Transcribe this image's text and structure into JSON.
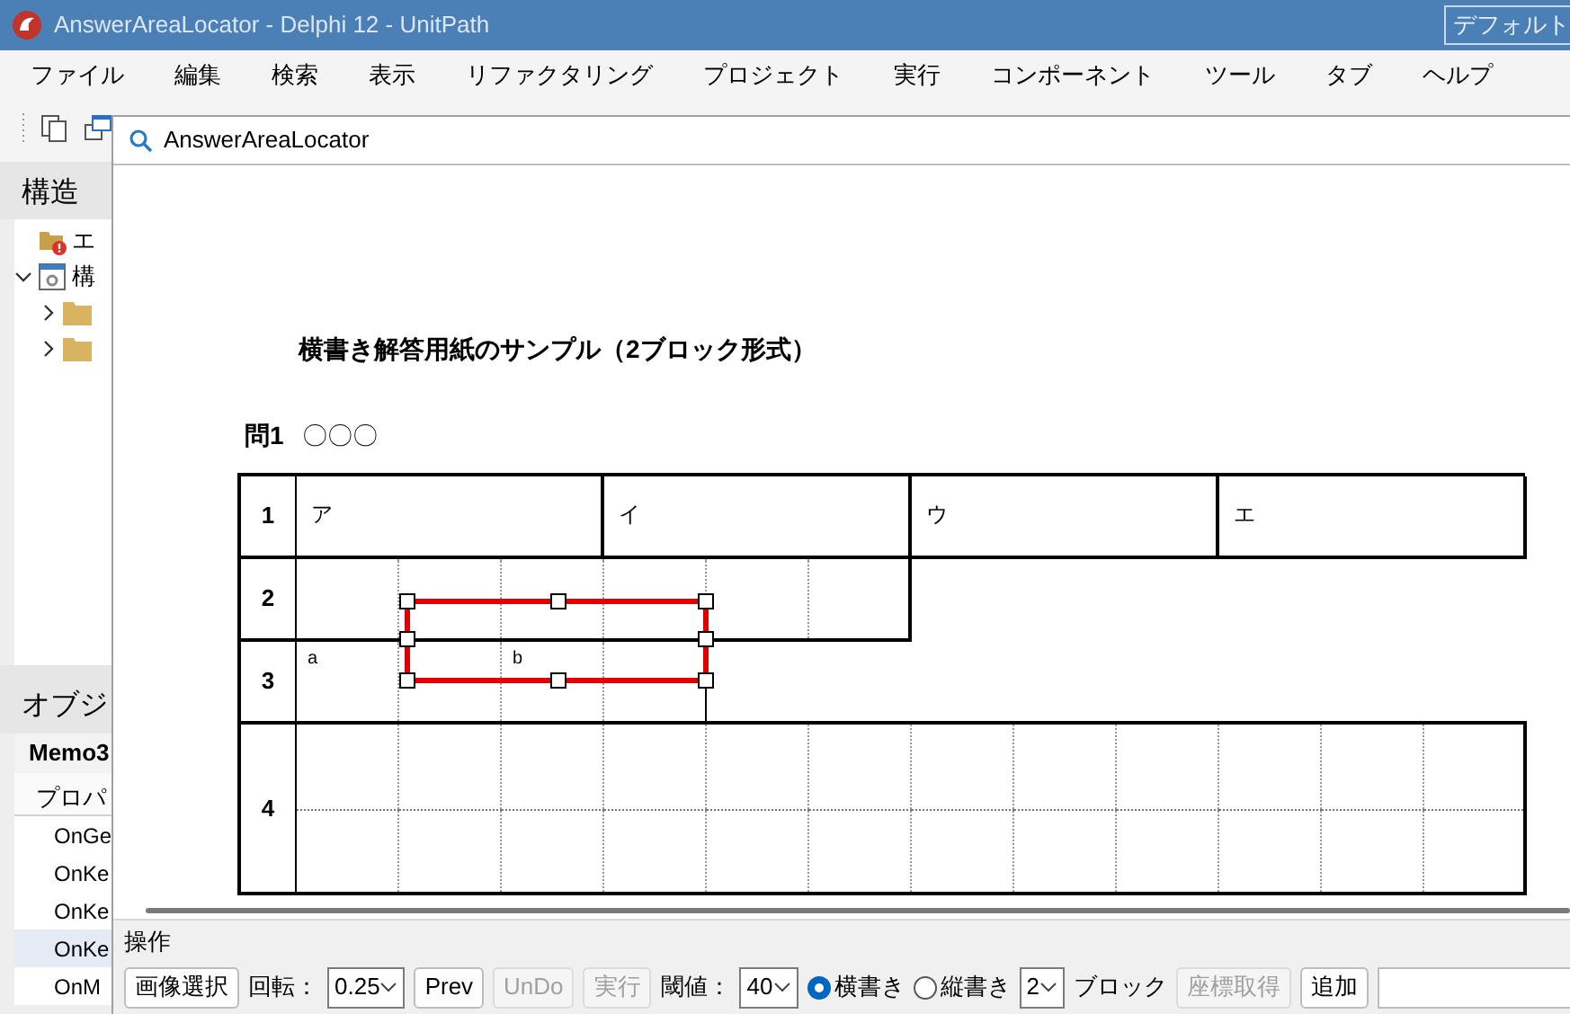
{
  "ide": {
    "title": "AnswerAreaLocator - Delphi 12 - UnitPath",
    "layout_box": "デフォルト",
    "menu": [
      "ファイル",
      "編集",
      "検索",
      "表示",
      "リファクタリング",
      "プロジェクト",
      "実行",
      "コンポーネント",
      "ツール",
      "タブ",
      "ヘルプ"
    ]
  },
  "structure_panel": {
    "title": "構造",
    "tree": [
      {
        "kind": "errors",
        "label": "エ"
      },
      {
        "kind": "form",
        "label": "構",
        "expanded": true,
        "children": [
          {
            "kind": "folder",
            "expanded": false
          },
          {
            "kind": "folder",
            "expanded": false
          }
        ]
      }
    ]
  },
  "object_inspector": {
    "title": "オブジ",
    "object": "Memo3",
    "tab": "プロパ",
    "properties": [
      {
        "name": "OnGe",
        "selected": false
      },
      {
        "name": "OnKe",
        "selected": false
      },
      {
        "name": "OnKe",
        "selected": false
      },
      {
        "name": "OnKe",
        "selected": true
      },
      {
        "name": "OnM",
        "selected": false
      }
    ]
  },
  "window": {
    "title": "AnswerAreaLocator",
    "sheet": {
      "title": "横書き解答用紙のサンプル（2ブロック形式）",
      "question_number": "問1",
      "question_text": "〇〇〇",
      "rows": [
        {
          "number": "1",
          "cells": [
            "ア",
            "イ",
            "ウ",
            "エ"
          ]
        },
        {
          "number": "2"
        },
        {
          "number": "3",
          "cells": [
            "a",
            "b"
          ]
        },
        {
          "number": "4"
        }
      ]
    },
    "group_title": "操作",
    "controls": [
      {
        "kind": "button",
        "label": "画像選択",
        "disabled": false
      },
      {
        "kind": "label",
        "label": "回転："
      },
      {
        "kind": "combo",
        "value": "0.25"
      },
      {
        "kind": "button",
        "label": "Prev",
        "disabled": false
      },
      {
        "kind": "button",
        "label": "UnDo",
        "disabled": true
      },
      {
        "kind": "button",
        "label": "実行",
        "disabled": true
      },
      {
        "kind": "label",
        "label": "閾値："
      },
      {
        "kind": "combo",
        "value": "40"
      },
      {
        "kind": "radio",
        "label": "横書き",
        "selected": true
      },
      {
        "kind": "radio",
        "label": "縦書き",
        "selected": false
      },
      {
        "kind": "combo",
        "value": "2"
      },
      {
        "kind": "label",
        "label": "ブロック"
      },
      {
        "kind": "button",
        "label": "座標取得",
        "disabled": true
      },
      {
        "kind": "button",
        "label": "追加",
        "disabled": false
      },
      {
        "kind": "field"
      }
    ]
  }
}
